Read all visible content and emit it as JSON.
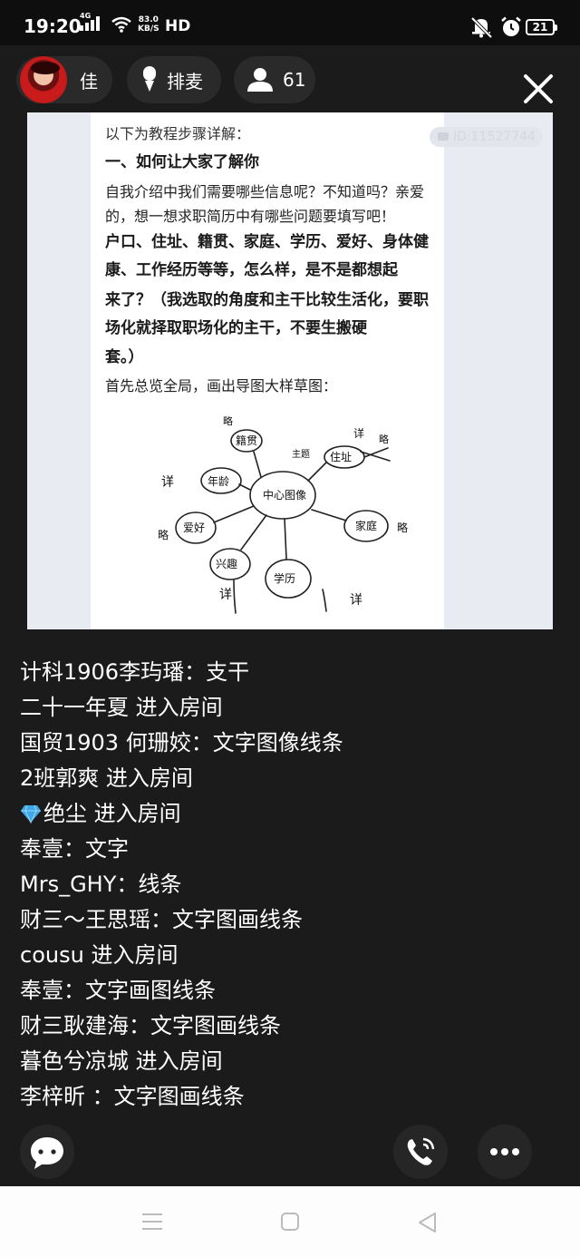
{
  "status_bar": {
    "time": "19:20",
    "network": "4G",
    "speed_value": "83.0",
    "speed_unit": "KB/S",
    "hd_label": "HD",
    "battery": "21"
  },
  "room": {
    "host_name": "佳",
    "mic_label": "排麦",
    "viewer_count": "61"
  },
  "shared_doc": {
    "watermark": "ID:11527744",
    "intro": "以下为教程步骤详解：",
    "heading": "一、如何让大家了解你",
    "paragraph": "自我介绍中我们需要哪些信息呢？不知道吗？亲爱的，想一想求职简历中有哪些问题要填写吧！",
    "bold_1": "户口、住址、籍贯、家庭、学历、爱好、身体健康、工作经历等等，怎么样，是不是都想起",
    "bold_2": "来了？（我选取的角度和主干比较生活化，要职场化就择取职场化的主干，不要生搬硬",
    "bold_3": "套。）",
    "step": "首先总览全局，画出导图大样草图：",
    "mindmap": {
      "center": "中心图像",
      "branches": [
        "年龄",
        "住址",
        "家庭",
        "学历",
        "兴趣",
        "爱好",
        "籍贯"
      ],
      "notes": [
        "略",
        "详",
        "主题",
        "略",
        "详",
        "详",
        "略",
        "略",
        "详",
        "详"
      ]
    }
  },
  "chat": [
    {
      "user": "计科1906李玙璠",
      "sep": "：",
      "text": "支干"
    },
    {
      "user": "二十一年夏",
      "sep": " ",
      "text": "进入房间"
    },
    {
      "user": "国贸1903 何珊姣",
      "sep": "：",
      "text": "文字图像线条"
    },
    {
      "user": "2班郭爽",
      "sep": " ",
      "text": "进入房间"
    },
    {
      "user": "绝尘",
      "sep": " ",
      "text": "进入房间",
      "badge": "gem-icon"
    },
    {
      "user": "奉壹",
      "sep": "：",
      "text": "文字"
    },
    {
      "user": "Mrs_GHY",
      "sep": "：",
      "text": "线条"
    },
    {
      "user": "财三～王思瑶",
      "sep": "：",
      "text": "文字图画线条"
    },
    {
      "user": "cousu",
      "sep": " ",
      "text": "进入房间"
    },
    {
      "user": "奉壹",
      "sep": "：",
      "text": "文字画图线条"
    },
    {
      "user": "财三耿建海",
      "sep": "：",
      "text": "文字图画线条"
    },
    {
      "user": "暮色兮凉城",
      "sep": " ",
      "text": "进入房间"
    },
    {
      "user": "李梓昕 ",
      "sep": "：",
      "text": "文字图画线条"
    }
  ],
  "colors": {
    "background": "#1b1b1b",
    "status_bar": "#0e0e0e",
    "pill": "#2a2a2a",
    "nav_bar": "#fdfdfd"
  }
}
